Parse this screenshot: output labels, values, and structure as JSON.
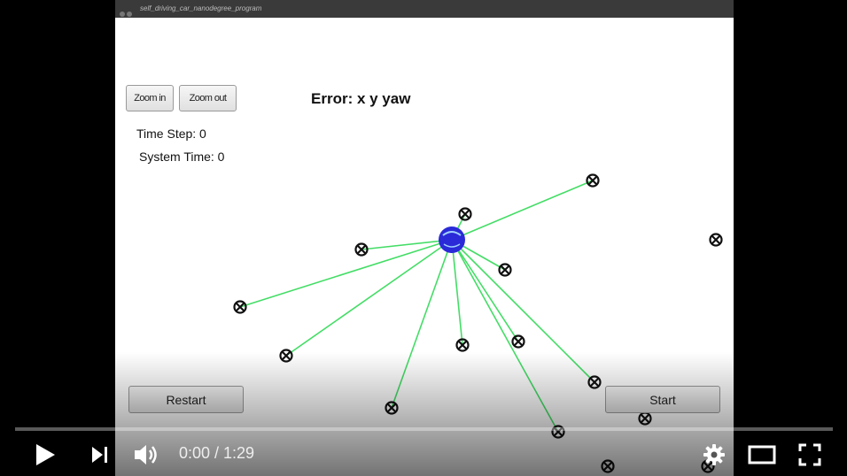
{
  "window": {
    "title": "self_driving_car_nanodegree_program"
  },
  "toolbar": {
    "zoom_in": "Zoom in",
    "zoom_out": "Zoom out"
  },
  "status": {
    "error_label": "Error: x y yaw",
    "time_step": "Time Step: 0",
    "system_time": "System Time: 0"
  },
  "buttons": {
    "restart": "Restart",
    "start": "Start"
  },
  "scene": {
    "car_color": "#2a2ad8",
    "ray_color": "#44dd66",
    "landmark_icon": "circled-x-icon",
    "landmark_count": 15
  },
  "player": {
    "time": "0:00 / 1:29",
    "play_icon": "play-icon",
    "next_icon": "next-icon",
    "volume_icon": "volume-icon",
    "settings_icon": "gear-icon",
    "theater_icon": "theater-mode-icon",
    "fullscreen_icon": "fullscreen-icon"
  }
}
